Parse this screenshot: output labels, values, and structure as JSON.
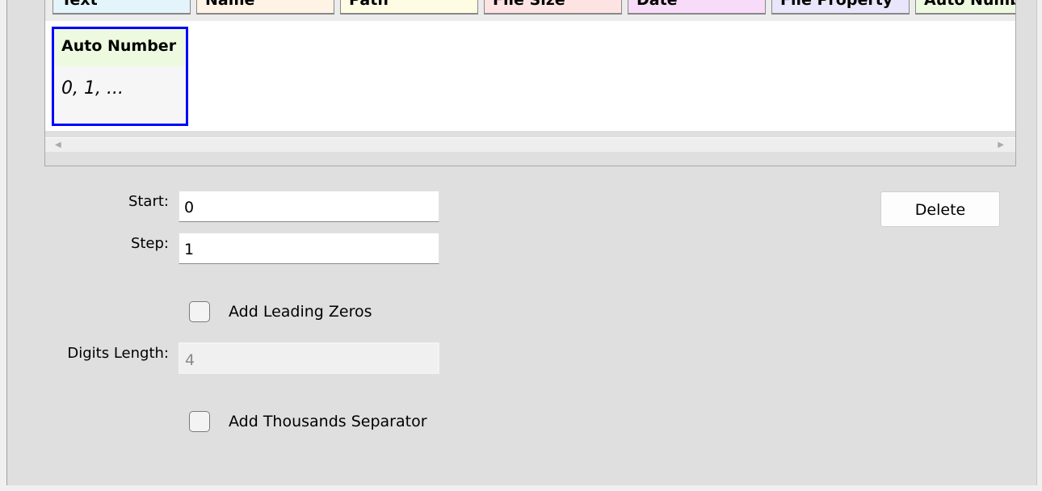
{
  "tabs": [
    {
      "label": "Text",
      "color": "#e3f4fb"
    },
    {
      "label": "Name",
      "color": "#fef3e5"
    },
    {
      "label": "Path",
      "color": "#fefde3"
    },
    {
      "label": "File Size",
      "color": "#fee3e3"
    },
    {
      "label": "Date",
      "color": "#f7dbf8"
    },
    {
      "label": "File Property",
      "color": "#e9e5fb"
    },
    {
      "label": "Auto Number",
      "color": "#eefadf"
    }
  ],
  "card": {
    "title": "Auto Number",
    "preview": "0, 1, ...",
    "border_color": "#0000ff"
  },
  "form": {
    "start_label": "Start:",
    "start_value": "0",
    "step_label": "Step:",
    "step_value": "1",
    "leading_zeros_label": "Add Leading Zeros",
    "leading_zeros_checked": false,
    "digits_label": "Digits Length:",
    "digits_value": "4",
    "thousands_label": "Add Thousands Separator",
    "thousands_checked": false
  },
  "delete_label": "Delete"
}
